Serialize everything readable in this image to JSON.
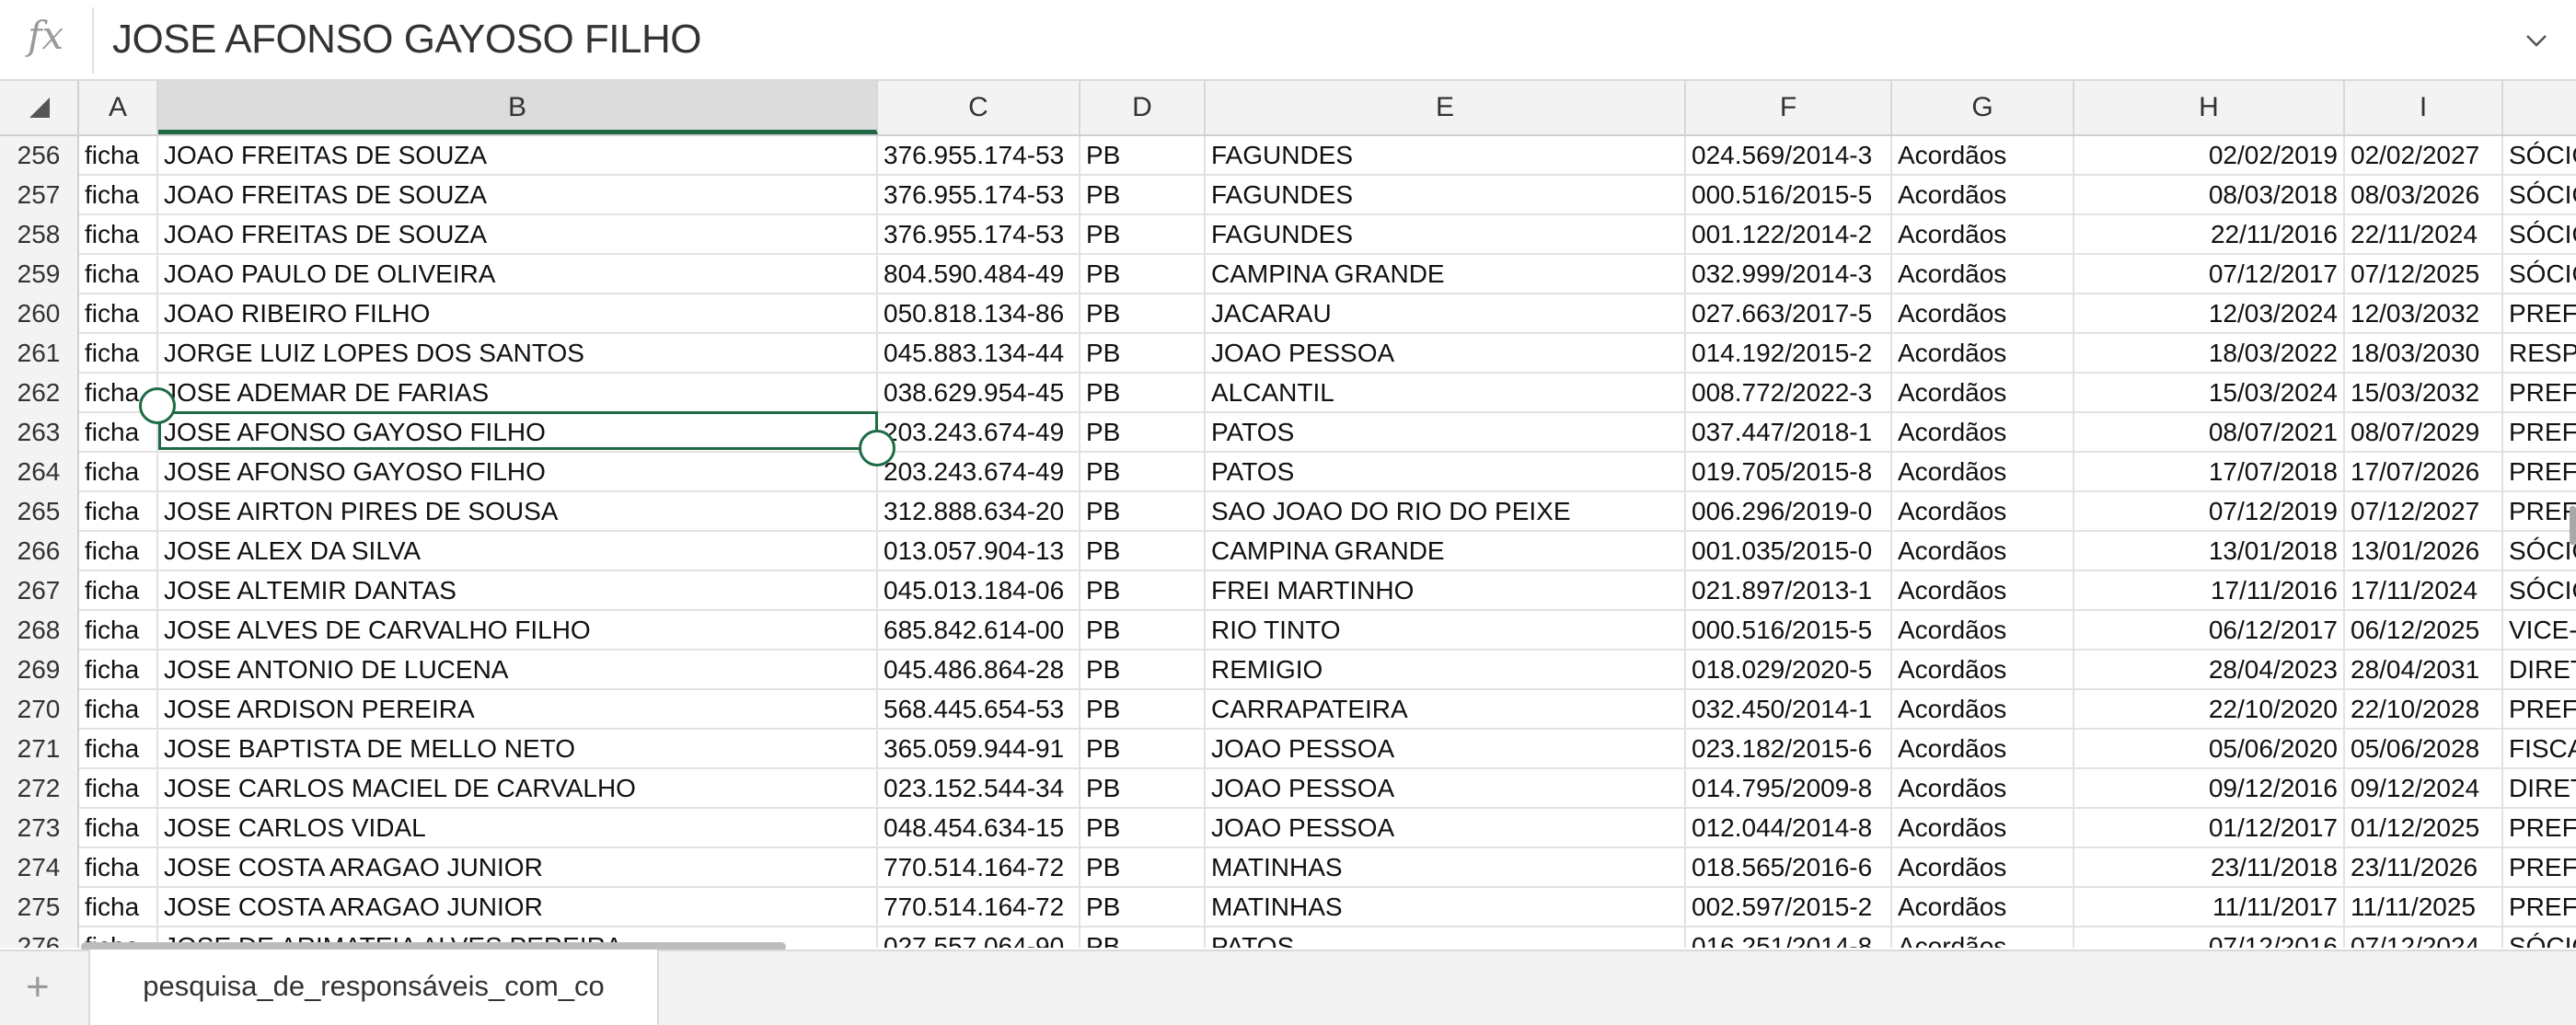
{
  "formula": {
    "fx_symbol": "fx",
    "value": "JOSE AFONSO GAYOSO FILHO"
  },
  "columns": [
    {
      "key": "A",
      "label": "A",
      "left": 0
    },
    {
      "key": "B",
      "label": "B"
    },
    {
      "key": "C",
      "label": "C"
    },
    {
      "key": "D",
      "label": "D"
    },
    {
      "key": "E",
      "label": "E"
    },
    {
      "key": "F",
      "label": "F"
    },
    {
      "key": "G",
      "label": "G"
    },
    {
      "key": "H",
      "label": "H"
    },
    {
      "key": "I",
      "label": "I"
    }
  ],
  "selected_column": "B",
  "selected_cell": {
    "row": "263",
    "column": "B"
  },
  "rows": [
    {
      "num": "256",
      "cells": [
        "ficha",
        "JOAO FREITAS DE SOUZA",
        "376.955.174-53",
        "PB",
        "FAGUNDES",
        "024.569/2014-3",
        "Acordãos",
        "02/02/2019",
        "02/02/2027",
        "SÓCIO"
      ]
    },
    {
      "num": "257",
      "cells": [
        "ficha",
        "JOAO FREITAS DE SOUZA",
        "376.955.174-53",
        "PB",
        "FAGUNDES",
        "000.516/2015-5",
        "Acordãos",
        "08/03/2018",
        "08/03/2026",
        "SÓCIO"
      ]
    },
    {
      "num": "258",
      "cells": [
        "ficha",
        "JOAO FREITAS DE SOUZA",
        "376.955.174-53",
        "PB",
        "FAGUNDES",
        "001.122/2014-2",
        "Acordãos",
        "22/11/2016",
        "22/11/2024",
        "SÓCIO"
      ]
    },
    {
      "num": "259",
      "cells": [
        "ficha",
        "JOAO PAULO DE OLIVEIRA",
        "804.590.484-49",
        "PB",
        "CAMPINA GRANDE",
        "032.999/2014-3",
        "Acordãos",
        "07/12/2017",
        "07/12/2025",
        "SÓCIO"
      ]
    },
    {
      "num": "260",
      "cells": [
        "ficha",
        "JOAO RIBEIRO FILHO",
        "050.818.134-86",
        "PB",
        "JACARAU",
        "027.663/2017-5",
        "Acordãos",
        "12/03/2024",
        "12/03/2032",
        "PREFE"
      ]
    },
    {
      "num": "261",
      "cells": [
        "ficha",
        "JORGE LUIZ LOPES DOS SANTOS",
        "045.883.134-44",
        "PB",
        "JOAO PESSOA",
        "014.192/2015-2",
        "Acordãos",
        "18/03/2022",
        "18/03/2030",
        "RESPO"
      ]
    },
    {
      "num": "262",
      "cells": [
        "ficha",
        "JOSE ADEMAR DE FARIAS",
        "038.629.954-45",
        "PB",
        "ALCANTIL",
        "008.772/2022-3",
        "Acordãos",
        "15/03/2024",
        "15/03/2032",
        "PREFE"
      ]
    },
    {
      "num": "263",
      "cells": [
        "ficha",
        "JOSE AFONSO GAYOSO FILHO",
        "203.243.674-49",
        "PB",
        "PATOS",
        "037.447/2018-1",
        "Acordãos",
        "08/07/2021",
        "08/07/2029",
        "PREFE"
      ]
    },
    {
      "num": "264",
      "cells": [
        "ficha",
        "JOSE AFONSO GAYOSO FILHO",
        "203.243.674-49",
        "PB",
        "PATOS",
        "019.705/2015-8",
        "Acordãos",
        "17/07/2018",
        "17/07/2026",
        "PREFE"
      ]
    },
    {
      "num": "265",
      "cells": [
        "ficha",
        "JOSE AIRTON PIRES DE SOUSA",
        "312.888.634-20",
        "PB",
        "SAO JOAO DO RIO DO PEIXE",
        "006.296/2019-0",
        "Acordãos",
        "07/12/2019",
        "07/12/2027",
        "PREFE"
      ]
    },
    {
      "num": "266",
      "cells": [
        "ficha",
        "JOSE ALEX DA SILVA",
        "013.057.904-13",
        "PB",
        "CAMPINA GRANDE",
        "001.035/2015-0",
        "Acordãos",
        "13/01/2018",
        "13/01/2026",
        "SÓCIO"
      ]
    },
    {
      "num": "267",
      "cells": [
        "ficha",
        "JOSE ALTEMIR DANTAS",
        "045.013.184-06",
        "PB",
        "FREI MARTINHO",
        "021.897/2013-1",
        "Acordãos",
        "17/11/2016",
        "17/11/2024",
        "SÓCIO"
      ]
    },
    {
      "num": "268",
      "cells": [
        "ficha",
        "JOSE ALVES DE CARVALHO FILHO",
        "685.842.614-00",
        "PB",
        "RIO TINTO",
        "000.516/2015-5",
        "Acordãos",
        "06/12/2017",
        "06/12/2025",
        "VICE-P"
      ]
    },
    {
      "num": "269",
      "cells": [
        "ficha",
        "JOSE ANTONIO DE LUCENA",
        "045.486.864-28",
        "PB",
        "REMIGIO",
        "018.029/2020-5",
        "Acordãos",
        "28/04/2023",
        "28/04/2031",
        "DIRET"
      ]
    },
    {
      "num": "270",
      "cells": [
        "ficha",
        "JOSE ARDISON PEREIRA",
        "568.445.654-53",
        "PB",
        "CARRAPATEIRA",
        "032.450/2014-1",
        "Acordãos",
        "22/10/2020",
        "22/10/2028",
        "PREFE"
      ]
    },
    {
      "num": "271",
      "cells": [
        "ficha",
        "JOSE BAPTISTA DE MELLO NETO",
        "365.059.944-91",
        "PB",
        "JOAO PESSOA",
        "023.182/2015-6",
        "Acordãos",
        "05/06/2020",
        "05/06/2028",
        "FISCAL"
      ]
    },
    {
      "num": "272",
      "cells": [
        "ficha",
        "JOSE CARLOS MACIEL DE CARVALHO",
        "023.152.544-34",
        "PB",
        "JOAO PESSOA",
        "014.795/2009-8",
        "Acordãos",
        "09/12/2016",
        "09/12/2024",
        "DIRET"
      ]
    },
    {
      "num": "273",
      "cells": [
        "ficha",
        "JOSE CARLOS VIDAL",
        "048.454.634-15",
        "PB",
        "JOAO PESSOA",
        "012.044/2014-8",
        "Acordãos",
        "01/12/2017",
        "01/12/2025",
        "PREFE"
      ]
    },
    {
      "num": "274",
      "cells": [
        "ficha",
        "JOSE COSTA ARAGAO JUNIOR",
        "770.514.164-72",
        "PB",
        "MATINHAS",
        "018.565/2016-6",
        "Acordãos",
        "23/11/2018",
        "23/11/2026",
        "PREFE"
      ]
    },
    {
      "num": "275",
      "cells": [
        "ficha",
        "JOSE COSTA ARAGAO JUNIOR",
        "770.514.164-72",
        "PB",
        "MATINHAS",
        "002.597/2015-2",
        "Acordãos",
        "11/11/2017",
        "11/11/2025",
        "PREFE"
      ]
    },
    {
      "num": "276",
      "cells": [
        "ficha",
        "JOSE DE ARIMATEIA ALVES PEREIRA",
        "027.557.064-90",
        "PB",
        "PATOS",
        "016.251/2014-8",
        "Acordãos",
        "07/12/2016",
        "07/12/2024",
        "SÓCIO"
      ]
    }
  ],
  "sheet_tabs": {
    "add_symbol": "+",
    "active": "pesquisa_de_responsáveis_com_co"
  },
  "colors": {
    "accent": "#1e6b45",
    "header_bg": "#f3f3f3",
    "grid_line": "#e2e2e2"
  },
  "icons": [
    "fx-icon",
    "chevron-down-icon",
    "select-all-icon",
    "add-sheet-icon"
  ]
}
